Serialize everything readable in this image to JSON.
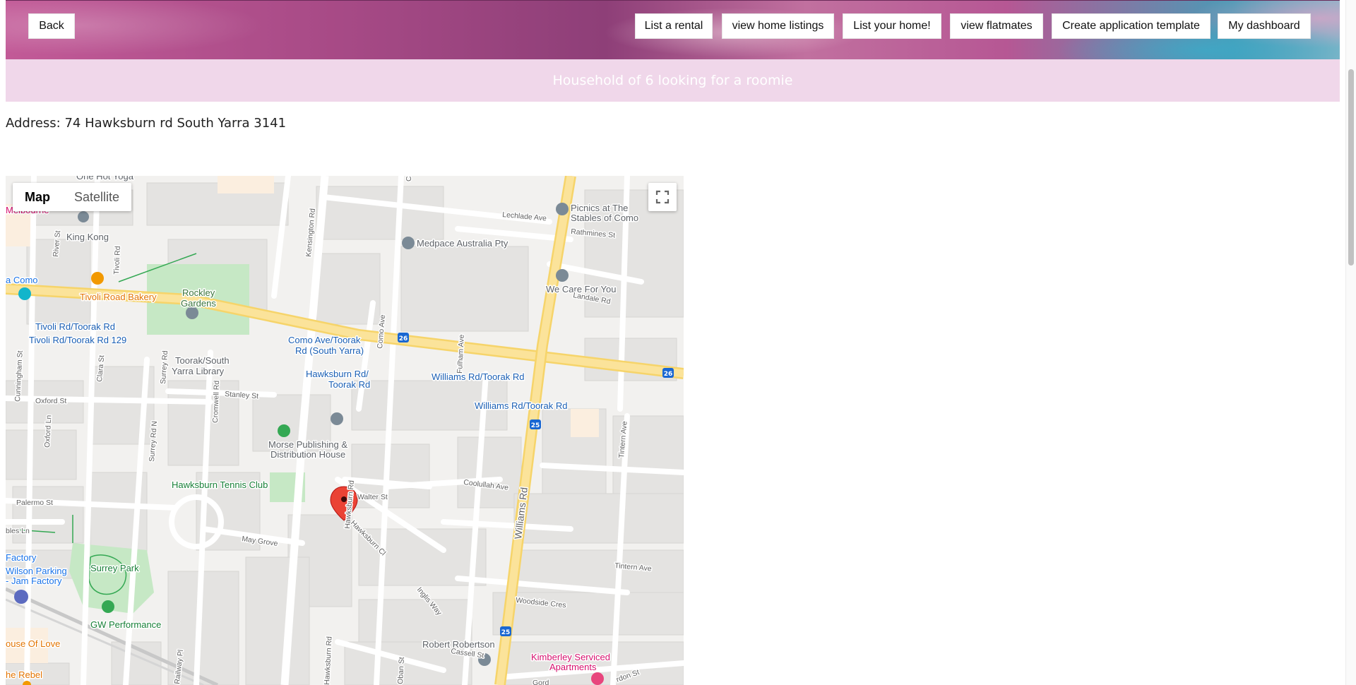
{
  "header": {
    "back_label": "Back",
    "nav": [
      {
        "label": "List a rental"
      },
      {
        "label": "view home listings"
      },
      {
        "label": "List your home!"
      },
      {
        "label": "view flatmates"
      },
      {
        "label": "Create application template"
      },
      {
        "label": "My dashboard"
      }
    ]
  },
  "banner": {
    "title": "Household of 6 looking for a roomie"
  },
  "address": {
    "text": "Address: 74 Hawksburn rd South Yarra 3141"
  },
  "map": {
    "type_control": {
      "map_label": "Map",
      "satellite_label": "Satellite",
      "selected": "Map"
    },
    "fullscreen_icon": "fullscreen-icon",
    "marker_icon": "map-pin-icon",
    "route_badges": [
      "26",
      "26",
      "25",
      "25"
    ],
    "places": [
      {
        "name": "One Hot Yoga",
        "color": "#5f6368"
      },
      {
        "name": "Melbourne",
        "color": "#d6106e"
      },
      {
        "name": "King Kong",
        "color": "#5f6368"
      },
      {
        "name": "Rockley",
        "color": "#3c763d"
      },
      {
        "name": "Gardens",
        "color": "#3c763d"
      },
      {
        "name": "Tivoli Road Bakery",
        "color": "#e37400"
      },
      {
        "name": "a Como",
        "color": "#1a73e8"
      },
      {
        "name": "Tivoli Rd/Toorak Rd",
        "color": "#1a5fb4"
      },
      {
        "name": "Tivoli Rd/Toorak Rd 129",
        "color": "#1a5fb4"
      },
      {
        "name": "Toorak/South",
        "color": "#5f6368"
      },
      {
        "name": "Yarra Library",
        "color": "#5f6368"
      },
      {
        "name": "Como Ave/Toorak",
        "color": "#1a5fb4"
      },
      {
        "name": "Rd (South Yarra)",
        "color": "#1a5fb4"
      },
      {
        "name": "Hawksburn Rd/",
        "color": "#1a5fb4"
      },
      {
        "name": "Toorak Rd",
        "color": "#1a5fb4"
      },
      {
        "name": "Williams Rd/Toorak Rd",
        "color": "#1a5fb4"
      },
      {
        "name": "Williams Rd/Toorak Rd",
        "color": "#1a5fb4"
      },
      {
        "name": "Picnics at The",
        "color": "#5f6368"
      },
      {
        "name": "Stables of Como",
        "color": "#5f6368"
      },
      {
        "name": "Medpace Australia Pty",
        "color": "#5f6368"
      },
      {
        "name": "We Care For You",
        "color": "#5f6368"
      },
      {
        "name": "Morse Publishing &",
        "color": "#5f6368"
      },
      {
        "name": "Distribution House",
        "color": "#5f6368"
      },
      {
        "name": "Hawksburn Tennis Club",
        "color": "#188038"
      },
      {
        "name": "Surrey Park",
        "color": "#188038"
      },
      {
        "name": "GW Performance",
        "color": "#188038"
      },
      {
        "name": "Robert Robertson",
        "color": "#5f6368"
      },
      {
        "name": "Kimberley Serviced",
        "color": "#d6106e"
      },
      {
        "name": "Apartments",
        "color": "#d6106e"
      },
      {
        "name": "Factory",
        "color": "#1a73e8"
      },
      {
        "name": "Wilson Parking",
        "color": "#1a73e8"
      },
      {
        "name": "- Jam Factory",
        "color": "#1a73e8"
      },
      {
        "name": "ouse Of Love",
        "color": "#e37400"
      },
      {
        "name": "he Rebel",
        "color": "#e37400"
      }
    ],
    "streets": [
      "Lechlade Ave",
      "Rathmines St",
      "Landale Rd",
      "Oxford St",
      "Stanley St",
      "Walter St",
      "Coolullah Ave",
      "Palermo St",
      "May Grove",
      "Hawksburn Cl",
      "Tintern Ave",
      "Woodside Cres",
      "Inglis Way",
      "Cassell St",
      "River St",
      "Tivoli Rd",
      "Kensington Rd",
      "Como Ave",
      "Fulham Ave",
      "Cunningham St",
      "Clara St",
      "Surrey Rd",
      "Cromwell Rd",
      "Oxford Ln",
      "Surrey Rd N",
      "Williams Rd",
      "Hawksburn Rd",
      "Tintern Ave",
      "Oban St",
      "Railway Pl",
      "Con",
      "bles Ln",
      "Gord",
      "rdon St"
    ]
  }
}
